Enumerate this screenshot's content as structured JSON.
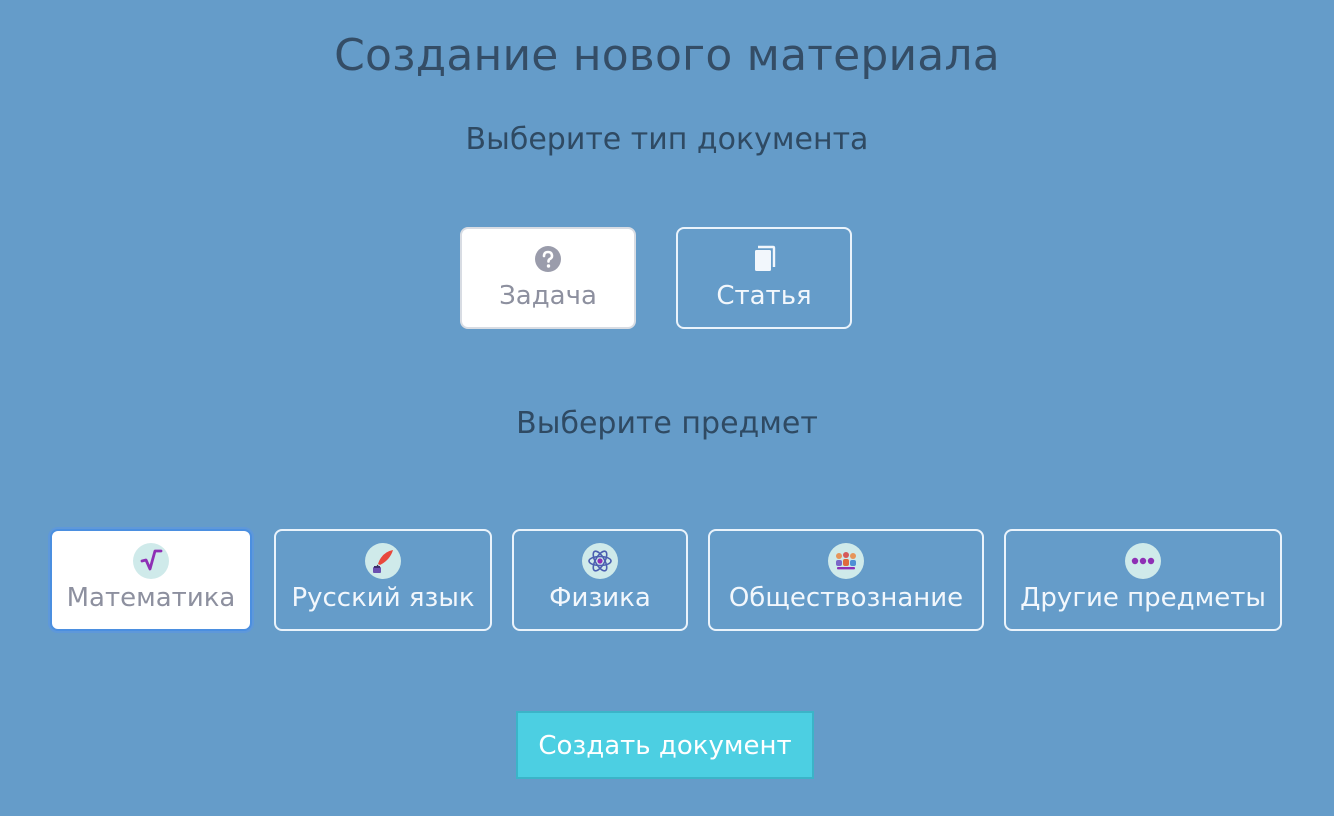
{
  "page": {
    "title": "Создание нового материала"
  },
  "document_type": {
    "heading": "Выберите тип документа",
    "options": [
      {
        "label": "Задача",
        "icon": "question-circle-icon",
        "selected": true
      },
      {
        "label": "Статья",
        "icon": "book-icon",
        "selected": false
      }
    ]
  },
  "subject": {
    "heading": "Выберите предмет",
    "options": [
      {
        "label": "Математика",
        "icon": "sqrt-icon",
        "selected": true
      },
      {
        "label": "Русский язык",
        "icon": "quill-ink-icon",
        "selected": false
      },
      {
        "label": "Физика",
        "icon": "atom-icon",
        "selected": false
      },
      {
        "label": "Обществознание",
        "icon": "people-icon",
        "selected": false
      },
      {
        "label": "Другие предметы",
        "icon": "ellipsis-icon",
        "selected": false
      }
    ]
  },
  "actions": {
    "create_label": "Создать документ"
  },
  "colors": {
    "background": "#659cc9",
    "button_border": "#eaf3fb",
    "selected_background": "#ffffff",
    "selected_text": "#8d909f",
    "primary_button": "#4ccfe2",
    "icon_circle": "#cfeaea",
    "math_icon": "#8e2fb5"
  }
}
